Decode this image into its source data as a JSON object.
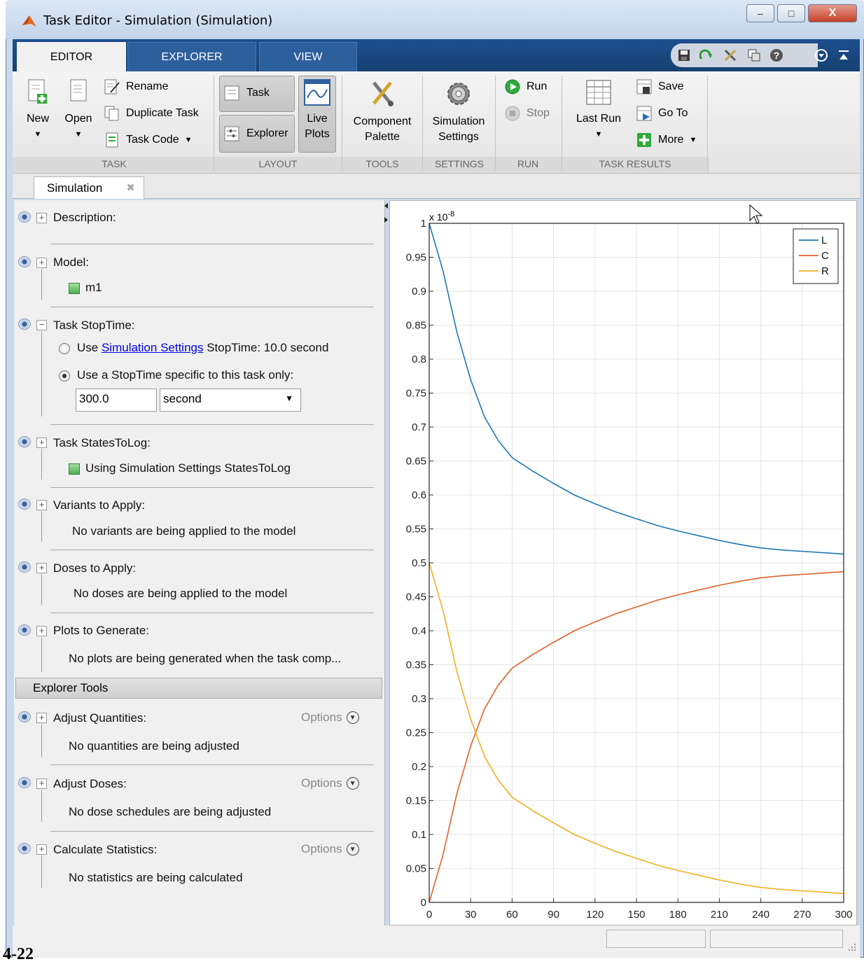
{
  "window": {
    "title": "Task Editor - Simulation (Simulation)",
    "minimize_glyph": "–",
    "maximize_glyph": "□",
    "close_glyph": "X"
  },
  "ribbon": {
    "tabs": [
      {
        "label": "EDITOR"
      },
      {
        "label": "EXPLORER"
      },
      {
        "label": "VIEW"
      }
    ],
    "groups": {
      "task": {
        "label": "TASK",
        "new_label": "New",
        "open_label": "Open",
        "rename_label": "Rename",
        "duplicate_label": "Duplicate Task",
        "task_code_label": "Task Code"
      },
      "layout": {
        "label": "LAYOUT",
        "task_label": "Task",
        "explorer_label": "Explorer",
        "live_plots_label_1": "Live",
        "live_plots_label_2": "Plots"
      },
      "tools": {
        "label": "TOOLS",
        "component_label_1": "Component",
        "component_label_2": "Palette"
      },
      "settings": {
        "label": "SETTINGS",
        "sim_label_1": "Simulation",
        "sim_label_2": "Settings"
      },
      "run": {
        "label": "RUN",
        "run_label": "Run",
        "stop_label": "Stop"
      },
      "results": {
        "label": "TASK RESULTS",
        "last_run_label": "Last Run",
        "save_label": "Save",
        "goto_label": "Go To",
        "more_label": "More"
      }
    }
  },
  "doc_tab": {
    "label": "Simulation",
    "close_glyph": "✖"
  },
  "task_panel": {
    "description": {
      "title": "Description:"
    },
    "model": {
      "title": "Model:",
      "value": "m1"
    },
    "stoptime": {
      "title": "Task StopTime:",
      "option1_prefix": "Use ",
      "option1_link": "Simulation Settings",
      "option1_suffix": " StopTime: 10.0 second",
      "option2": "Use a StopTime specific to this task only:",
      "value": "300.0",
      "unit": "second"
    },
    "states": {
      "title": "Task StatesToLog:",
      "value": "Using Simulation Settings StatesToLog"
    },
    "variants": {
      "title": "Variants to Apply:",
      "value": "No variants are being applied to the model"
    },
    "doses": {
      "title": "Doses to Apply:",
      "value": "No doses are being applied to the model"
    },
    "plots": {
      "title": "Plots to Generate:",
      "value": "No plots are being generated when the task comp..."
    },
    "explorer_tools": "Explorer Tools",
    "adjust_quantities": {
      "title": "Adjust Quantities:",
      "options": "Options",
      "value": "No quantities are being adjusted"
    },
    "adjust_doses": {
      "title": "Adjust Doses:",
      "options": "Options",
      "value": "No dose schedules are being adjusted"
    },
    "statistics": {
      "title": "Calculate Statistics:",
      "options": "Options",
      "value": "No statistics are being calculated"
    }
  },
  "footer_text": "4-22",
  "colors": {
    "L": "#1f77b4",
    "C": "#e0612a",
    "R": "#f0b020",
    "ribbon_blue": "#1e4f8f"
  },
  "chart_data": {
    "type": "line",
    "multiplier": "x 10",
    "multiplier_exp": "-8",
    "x": [
      0,
      5,
      10,
      20,
      30,
      40,
      50,
      60,
      75,
      90,
      105,
      120,
      135,
      150,
      165,
      180,
      195,
      210,
      225,
      240,
      255,
      270,
      285,
      300
    ],
    "series": [
      {
        "name": "L",
        "values": [
          1.0,
          0.965,
          0.93,
          0.84,
          0.77,
          0.715,
          0.68,
          0.655,
          0.635,
          0.617,
          0.6,
          0.587,
          0.575,
          0.565,
          0.555,
          0.547,
          0.54,
          0.533,
          0.527,
          0.522,
          0.519,
          0.517,
          0.515,
          0.513
        ]
      },
      {
        "name": "C",
        "values": [
          0.0,
          0.035,
          0.07,
          0.16,
          0.23,
          0.285,
          0.32,
          0.345,
          0.365,
          0.383,
          0.4,
          0.413,
          0.425,
          0.435,
          0.445,
          0.453,
          0.46,
          0.467,
          0.473,
          0.478,
          0.481,
          0.483,
          0.485,
          0.487
        ]
      },
      {
        "name": "R",
        "values": [
          0.5,
          0.465,
          0.43,
          0.34,
          0.27,
          0.215,
          0.18,
          0.155,
          0.135,
          0.117,
          0.1,
          0.087,
          0.075,
          0.065,
          0.055,
          0.047,
          0.04,
          0.033,
          0.027,
          0.022,
          0.019,
          0.017,
          0.015,
          0.013
        ]
      }
    ],
    "xticks": [
      0,
      30,
      60,
      90,
      120,
      150,
      180,
      210,
      240,
      270,
      300
    ],
    "xlim": [
      0,
      300
    ],
    "yticks": [
      0,
      0.05,
      0.1,
      0.15,
      0.2,
      0.25,
      0.3,
      0.35,
      0.4,
      0.45,
      0.5,
      0.55,
      0.6,
      0.65,
      0.7,
      0.75,
      0.8,
      0.85,
      0.9,
      0.95,
      1
    ],
    "ytick_labels": [
      "0",
      "0.05",
      "0.1",
      "0.15",
      "0.2",
      "0.25",
      "0.3",
      "0.35",
      "0.4",
      "0.45",
      "0.5",
      "0.55",
      "0.6",
      "0.65",
      "0.7",
      "0.75",
      "0.8",
      "0.85",
      "0.9",
      "0.95",
      "1"
    ],
    "ylim": [
      0,
      1
    ],
    "grid": true,
    "legend": "top-right"
  }
}
